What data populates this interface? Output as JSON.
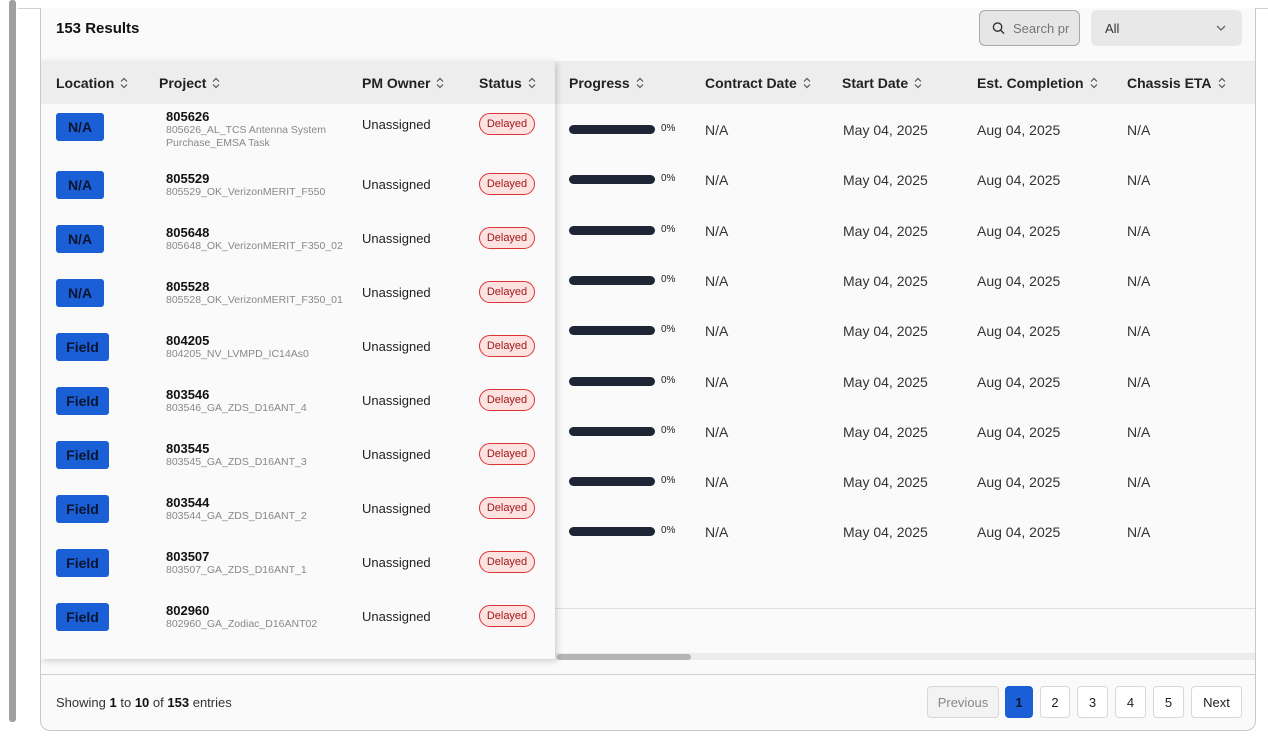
{
  "header": {
    "results_title": "153 Results",
    "search_placeholder": "Search pr",
    "filter_value": "All"
  },
  "columns": {
    "location": "Location",
    "project": "Project",
    "pm_owner": "PM Owner",
    "status": "Status",
    "progress": "Progress",
    "contract_date": "Contract Date",
    "start_date": "Start Date",
    "est_completion": "Est. Completion",
    "chassis_eta": "Chassis ETA"
  },
  "rows": [
    {
      "location": "N/A",
      "project_number": "805626",
      "project_name": "805626_AL_TCS Antenna System Purchase_EMSA Task",
      "pm_owner": "Unassigned",
      "status": "Delayed",
      "progress": 0,
      "progress_label": "0%",
      "contract_date": "N/A",
      "start_date": "May 04, 2025",
      "est_completion": "Aug 04, 2025",
      "chassis_eta": "N/A"
    },
    {
      "location": "N/A",
      "project_number": "805529",
      "project_name": "805529_OK_VerizonMERIT_F550",
      "pm_owner": "Unassigned",
      "status": "Delayed",
      "progress": 0,
      "progress_label": "0%",
      "contract_date": "N/A",
      "start_date": "May 04, 2025",
      "est_completion": "Aug 04, 2025",
      "chassis_eta": "N/A"
    },
    {
      "location": "N/A",
      "project_number": "805648",
      "project_name": "805648_OK_VerizonMERIT_F350_02",
      "pm_owner": "Unassigned",
      "status": "Delayed",
      "progress": 0,
      "progress_label": "0%",
      "contract_date": "N/A",
      "start_date": "May 04, 2025",
      "est_completion": "Aug 04, 2025",
      "chassis_eta": "N/A"
    },
    {
      "location": "N/A",
      "project_number": "805528",
      "project_name": "805528_OK_VerizonMERIT_F350_01",
      "pm_owner": "Unassigned",
      "status": "Delayed",
      "progress": 0,
      "progress_label": "0%",
      "contract_date": "N/A",
      "start_date": "May 04, 2025",
      "est_completion": "Aug 04, 2025",
      "chassis_eta": "N/A"
    },
    {
      "location": "Field",
      "project_number": "804205",
      "project_name": "804205_NV_LVMPD_IC14As0",
      "pm_owner": "Unassigned",
      "status": "Delayed",
      "progress": 0,
      "progress_label": "0%",
      "contract_date": "N/A",
      "start_date": "May 04, 2025",
      "est_completion": "Aug 04, 2025",
      "chassis_eta": "N/A"
    },
    {
      "location": "Field",
      "project_number": "803546",
      "project_name": "803546_GA_ZDS_D16ANT_4",
      "pm_owner": "Unassigned",
      "status": "Delayed",
      "progress": 0,
      "progress_label": "0%",
      "contract_date": "N/A",
      "start_date": "May 04, 2025",
      "est_completion": "Aug 04, 2025",
      "chassis_eta": "N/A"
    },
    {
      "location": "Field",
      "project_number": "803545",
      "project_name": "803545_GA_ZDS_D16ANT_3",
      "pm_owner": "Unassigned",
      "status": "Delayed",
      "progress": 0,
      "progress_label": "0%",
      "contract_date": "N/A",
      "start_date": "May 04, 2025",
      "est_completion": "Aug 04, 2025",
      "chassis_eta": "N/A"
    },
    {
      "location": "Field",
      "project_number": "803544",
      "project_name": "803544_GA_ZDS_D16ANT_2",
      "pm_owner": "Unassigned",
      "status": "Delayed",
      "progress": 0,
      "progress_label": "0%",
      "contract_date": "N/A",
      "start_date": "May 04, 2025",
      "est_completion": "Aug 04, 2025",
      "chassis_eta": "N/A"
    },
    {
      "location": "Field",
      "project_number": "803507",
      "project_name": "803507_GA_ZDS_D16ANT_1",
      "pm_owner": "Unassigned",
      "status": "Delayed",
      "progress": 0,
      "progress_label": "0%",
      "contract_date": "N/A",
      "start_date": "May 04, 2025",
      "est_completion": "Aug 04, 2025",
      "chassis_eta": "N/A"
    },
    {
      "location": "Field",
      "project_number": "802960",
      "project_name": "802960_GA_Zodiac_D16ANT02",
      "pm_owner": "Unassigned",
      "status": "Delayed",
      "progress": null,
      "progress_label": "",
      "contract_date": "",
      "start_date": "",
      "est_completion": "",
      "chassis_eta": ""
    }
  ],
  "footer": {
    "showing_prefix": "Showing",
    "from": "1",
    "to_word": "to",
    "to": "10",
    "of_word": "of",
    "total": "153",
    "entries_word": "entries"
  },
  "pagination": {
    "previous": "Previous",
    "pages": [
      "1",
      "2",
      "3",
      "4",
      "5"
    ],
    "current": "1",
    "next": "Next"
  },
  "colors": {
    "location_badge": "#1a5fd6",
    "status_delayed_border": "#dd3333",
    "status_delayed_bg": "#fde2e2",
    "progress_track": "#1e2535",
    "active_page": "#1a5fd6"
  }
}
